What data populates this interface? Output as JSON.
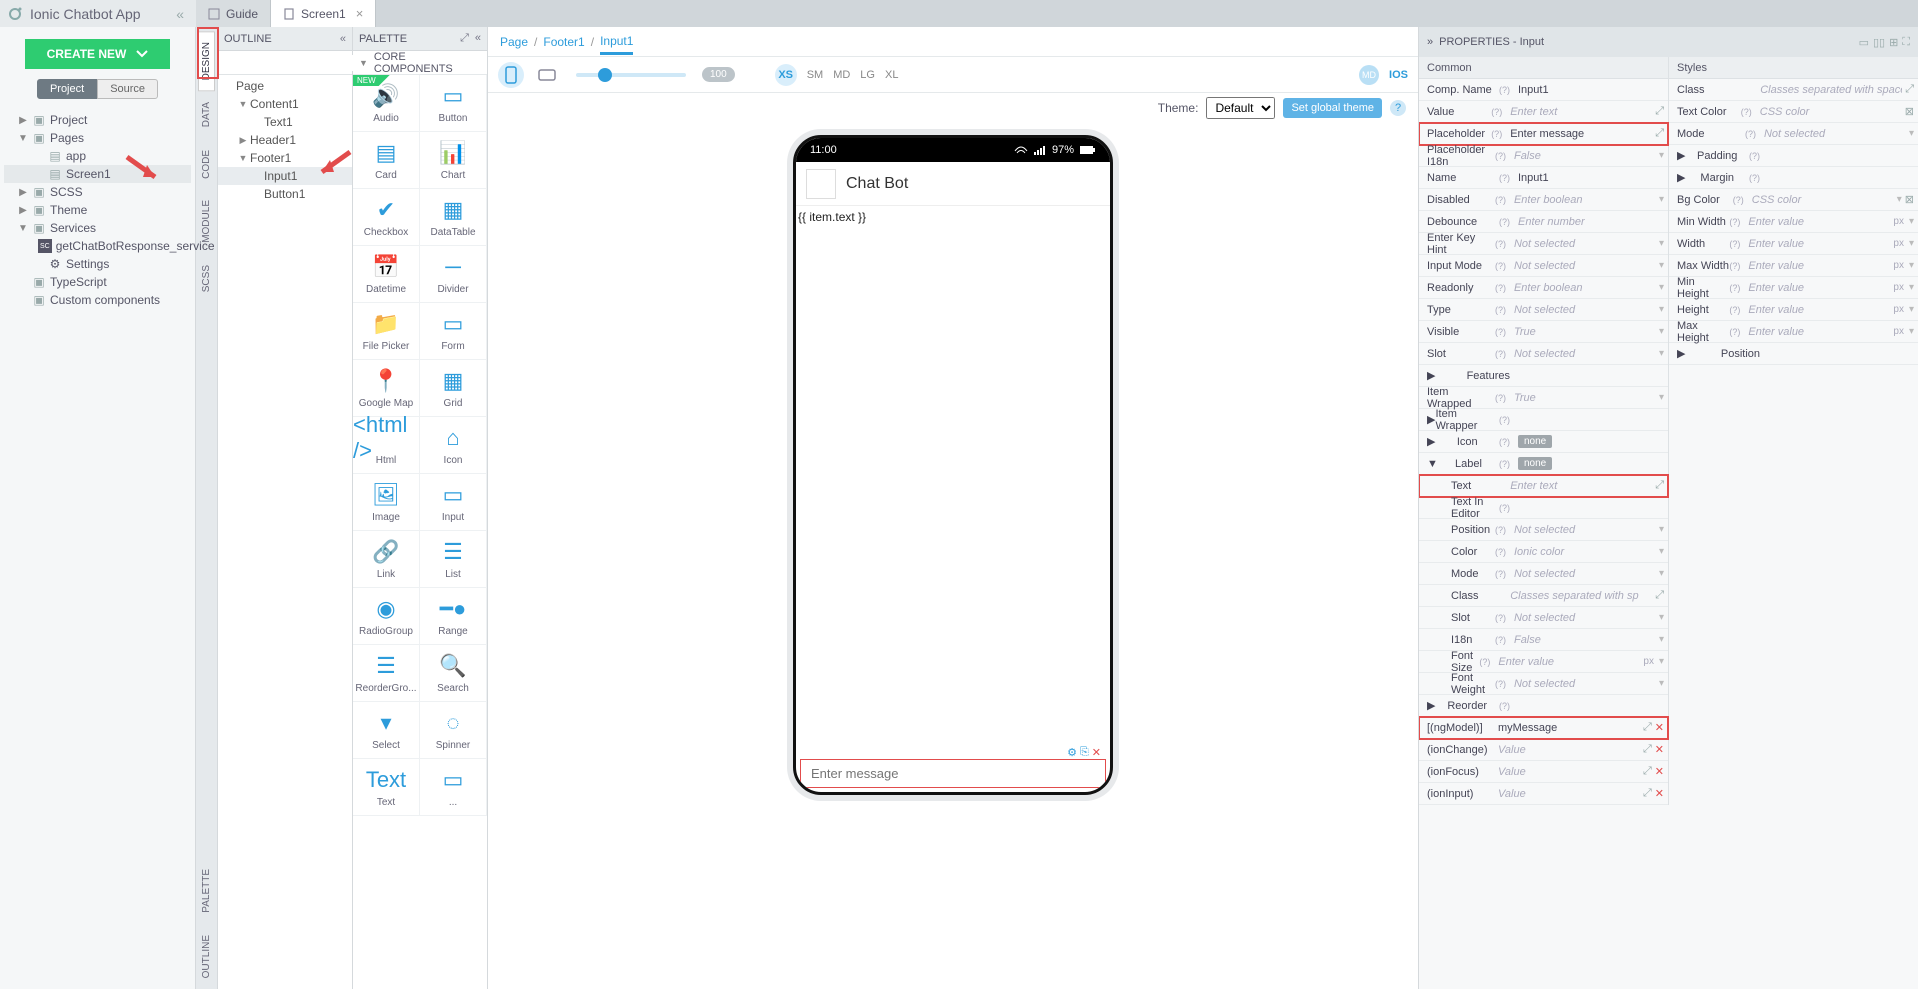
{
  "appTitle": "Ionic Chatbot App",
  "tabs": [
    {
      "label": "Guide",
      "icon": "book",
      "active": false
    },
    {
      "label": "Screen1",
      "icon": "page",
      "active": true
    }
  ],
  "createBtn": "CREATE NEW",
  "projectSourceToggle": {
    "project": "Project",
    "source": "Source"
  },
  "projectTree": [
    {
      "label": "Project",
      "type": "folder",
      "tw": "▶",
      "ind": 1
    },
    {
      "label": "Pages",
      "type": "folder",
      "tw": "▼",
      "ind": 1
    },
    {
      "label": "app",
      "type": "page",
      "tw": "",
      "ind": 2
    },
    {
      "label": "Screen1",
      "type": "page",
      "tw": "",
      "ind": 2,
      "sel": true
    },
    {
      "label": "SCSS",
      "type": "folder",
      "tw": "▶",
      "ind": 1
    },
    {
      "label": "Theme",
      "type": "folder",
      "tw": "▶",
      "ind": 1
    },
    {
      "label": "Services",
      "type": "folder",
      "tw": "▼",
      "ind": 1
    },
    {
      "label": "getChatBotResponse_service",
      "type": "sc",
      "tw": "",
      "ind": 2
    },
    {
      "label": "Settings",
      "type": "gear",
      "tw": "",
      "ind": 2
    },
    {
      "label": "TypeScript",
      "type": "folder",
      "tw": "",
      "ind": 1
    },
    {
      "label": "Custom components",
      "type": "folder",
      "tw": "",
      "ind": 1
    }
  ],
  "rails": {
    "design": "DESIGN",
    "data": "DATA",
    "code": "CODE",
    "module": "MODULE",
    "scss": "SCSS",
    "palette": "PALETTE",
    "outline": "OUTLINE"
  },
  "outlineHeader": "OUTLINE",
  "outlineTree": [
    {
      "label": "Page",
      "ind": 0,
      "tw": ""
    },
    {
      "label": "Content1",
      "ind": 1,
      "tw": "▼"
    },
    {
      "label": "Text1",
      "ind": 2,
      "tw": ""
    },
    {
      "label": "Header1",
      "ind": 1,
      "tw": "▶"
    },
    {
      "label": "Footer1",
      "ind": 1,
      "tw": "▼"
    },
    {
      "label": "Input1",
      "ind": 2,
      "tw": "",
      "sel": true
    },
    {
      "label": "Button1",
      "ind": 2,
      "tw": ""
    }
  ],
  "paletteHeader": "PALETTE",
  "paletteCat": "CORE COMPONENTS",
  "paletteItems": [
    "Audio",
    "Button",
    "Card",
    "Chart",
    "Checkbox",
    "DataTable",
    "Datetime",
    "Divider",
    "File Picker",
    "Form",
    "Google Map",
    "Grid",
    "Html",
    "Icon",
    "Image",
    "Input",
    "Link",
    "List",
    "RadioGroup",
    "Range",
    "ReorderGro...",
    "Search",
    "Select",
    "Spinner",
    "Text",
    "..."
  ],
  "breadcrumb": [
    "Page",
    "Footer1",
    "Input1"
  ],
  "sizes": [
    "XS",
    "SM",
    "MD",
    "LG",
    "XL"
  ],
  "sizePill": "100",
  "osToggle": {
    "md": "MD",
    "ios": "IOS"
  },
  "themeLabel": "Theme:",
  "themeOptions": [
    "Default"
  ],
  "setGlobal": "Set global theme",
  "device": {
    "time": "11:00",
    "battery": "97%",
    "headerTitle": "Chat Bot",
    "bodyText": "{{ item.text }}",
    "footerPlaceholder": "Enter message"
  },
  "propsHeader": "PROPERTIES - Input",
  "colHeaders": {
    "common": "Common",
    "styles": "Styles"
  },
  "commonProps": [
    {
      "lbl": "Comp. Name",
      "q": "(?)",
      "val": "Input1",
      "type": "text"
    },
    {
      "lbl": "Value",
      "q": "(?)",
      "ph": "Enter text",
      "end": "⤢",
      "type": "text"
    },
    {
      "lbl": "Placeholder",
      "q": "(?)",
      "val": "Enter message",
      "end": "⤢",
      "type": "text",
      "hl": true
    },
    {
      "lbl": "Placeholder I18n",
      "q": "(?)",
      "ph": "False",
      "caret": "▾",
      "type": "sel"
    },
    {
      "lbl": "Name",
      "q": "(?)",
      "val": "Input1",
      "type": "text"
    },
    {
      "lbl": "Disabled",
      "q": "(?)",
      "ph": "Enter boolean",
      "caret": "▾",
      "type": "sel"
    },
    {
      "lbl": "Debounce",
      "q": "(?)",
      "ph": "Enter number",
      "type": "text"
    },
    {
      "lbl": "Enter Key Hint",
      "q": "(?)",
      "ph": "Not selected",
      "caret": "▾",
      "type": "sel"
    },
    {
      "lbl": "Input Mode",
      "q": "(?)",
      "ph": "Not selected",
      "caret": "▾",
      "type": "sel"
    },
    {
      "lbl": "Readonly",
      "q": "(?)",
      "ph": "Enter boolean",
      "caret": "▾",
      "type": "sel"
    },
    {
      "lbl": "Type",
      "q": "(?)",
      "ph": "Not selected",
      "caret": "▾",
      "type": "sel"
    },
    {
      "lbl": "Visible",
      "q": "(?)",
      "ph": "True",
      "caret": "▾",
      "type": "sel"
    },
    {
      "lbl": "Slot",
      "q": "(?)",
      "ph": "Not selected",
      "caret": "▾",
      "type": "sel"
    },
    {
      "lbl": "Features",
      "tw": "▶",
      "type": "exp"
    },
    {
      "lbl": "Item Wrapped",
      "q": "(?)",
      "ph": "True",
      "caret": "▾",
      "type": "sel"
    },
    {
      "lbl": "Item Wrapper",
      "q": "(?)",
      "tw": "▶",
      "type": "exp"
    },
    {
      "lbl": "Icon",
      "q": "(?)",
      "badge": "none",
      "tw": "▶",
      "type": "badge"
    },
    {
      "lbl": "Label",
      "q": "(?)",
      "badge": "none",
      "tw": "▼",
      "type": "badge"
    },
    {
      "lbl": "Text",
      "ph": "Enter text",
      "end": "⤢",
      "type": "text",
      "sub": 2,
      "hl": true
    },
    {
      "lbl": "Text In Editor",
      "q": "(?)",
      "type": "text",
      "sub": 2
    },
    {
      "lbl": "Position",
      "q": "(?)",
      "ph": "Not selected",
      "caret": "▾",
      "type": "sel",
      "sub": 2
    },
    {
      "lbl": "Color",
      "q": "(?)",
      "ph": "Ionic color",
      "caret": "▾",
      "type": "sel",
      "sub": 2
    },
    {
      "lbl": "Mode",
      "q": "(?)",
      "ph": "Not selected",
      "caret": "▾",
      "type": "sel",
      "sub": 2
    },
    {
      "lbl": "Class",
      "ph": "Classes separated with sp",
      "end": "⤢",
      "type": "text",
      "sub": 2
    },
    {
      "lbl": "Slot",
      "q": "(?)",
      "ph": "Not selected",
      "caret": "▾",
      "type": "sel",
      "sub": 2
    },
    {
      "lbl": "I18n",
      "q": "(?)",
      "ph": "False",
      "caret": "▾",
      "type": "sel",
      "sub": 2
    },
    {
      "lbl": "Font Size",
      "q": "(?)",
      "ph": "Enter value",
      "unit": "px",
      "caret": "▾",
      "type": "text",
      "sub": 2
    },
    {
      "lbl": "Font Weight",
      "q": "(?)",
      "ph": "Not selected",
      "caret": "▾",
      "type": "sel",
      "sub": 2
    },
    {
      "lbl": "Reorder",
      "q": "(?)",
      "tw": "▶",
      "type": "exp"
    },
    {
      "lbl": "[(ngModel)]",
      "val": "myMessage",
      "end": "⤢",
      "end2": "✕",
      "type": "text",
      "hl": true
    },
    {
      "lbl": "(ionChange)",
      "ph": "Value",
      "end": "⤢",
      "end2": "✕",
      "type": "text"
    },
    {
      "lbl": "(ionFocus)",
      "ph": "Value",
      "end": "⤢",
      "end2": "✕",
      "type": "text"
    },
    {
      "lbl": "(ionInput)",
      "ph": "Value",
      "end": "⤢",
      "end2": "✕",
      "type": "text"
    }
  ],
  "styleProps": [
    {
      "lbl": "Class",
      "ph": "Classes separated with space",
      "end": "⤢",
      "type": "text"
    },
    {
      "lbl": "Text Color",
      "q": "(?)",
      "ph": "CSS color",
      "end": "⊠",
      "type": "text"
    },
    {
      "lbl": "Mode",
      "q": "(?)",
      "ph": "Not selected",
      "caret": "▾",
      "type": "sel"
    },
    {
      "lbl": "Padding",
      "q": "(?)",
      "tw": "▶",
      "type": "exp"
    },
    {
      "lbl": "Margin",
      "q": "(?)",
      "tw": "▶",
      "type": "exp"
    },
    {
      "lbl": "Bg Color",
      "q": "(?)",
      "ph": "CSS color",
      "caret": "▾",
      "end": "⊠",
      "type": "text"
    },
    {
      "lbl": "Min Width",
      "q": "(?)",
      "ph": "Enter value",
      "unit": "px",
      "caret": "▾",
      "type": "text"
    },
    {
      "lbl": "Width",
      "q": "(?)",
      "ph": "Enter value",
      "unit": "px",
      "caret": "▾",
      "type": "text"
    },
    {
      "lbl": "Max Width",
      "q": "(?)",
      "ph": "Enter value",
      "unit": "px",
      "caret": "▾",
      "type": "text"
    },
    {
      "lbl": "Min Height",
      "q": "(?)",
      "ph": "Enter value",
      "unit": "px",
      "caret": "▾",
      "type": "text"
    },
    {
      "lbl": "Height",
      "q": "(?)",
      "ph": "Enter value",
      "unit": "px",
      "caret": "▾",
      "type": "text"
    },
    {
      "lbl": "Max Height",
      "q": "(?)",
      "ph": "Enter value",
      "unit": "px",
      "caret": "▾",
      "type": "text"
    },
    {
      "lbl": "Position",
      "tw": "▶",
      "type": "exp"
    }
  ]
}
